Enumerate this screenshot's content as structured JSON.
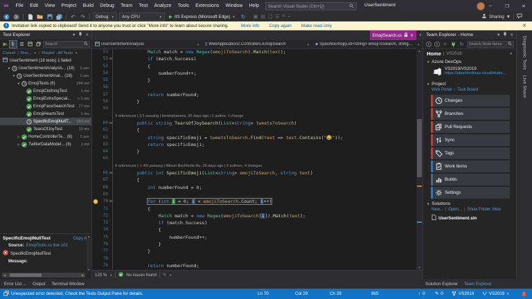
{
  "window": {
    "title": "UserSentiment",
    "search_placeholder": "Search Visual Studio (Ctrl+Q)",
    "minimize": "─",
    "maximize": "❐",
    "close": "✕"
  },
  "menu": [
    "File",
    "Edit",
    "View",
    "Project",
    "Build",
    "Debug",
    "Team",
    "Test",
    "Analyze",
    "Tools",
    "Extensions",
    "Window",
    "Help"
  ],
  "toolbar": {
    "config": "Debug",
    "platform": "Any CPU",
    "start": "IIS Express (Microsoft Edge)",
    "sharing": "Sharing"
  },
  "notification": {
    "text": "Invitation link copied to clipboard! Send it to anyone you trust or click \"More info\" to learn about secure sharing.",
    "links": [
      "More info",
      "Copy again",
      "Make read-only"
    ]
  },
  "test_explorer": {
    "title": "Test Explorer",
    "search_placeholder": "Search",
    "cmd_cancel": "Cancel",
    "cmd_run": "Run...",
    "cmd_playlist": "Playlist : All Tests",
    "root_label": "UserSentiment (18 tests) 1 failed",
    "tree": [
      {
        "label": "UserSentimentAnalysis... (18)",
        "time": "1 sec",
        "icon": "clock",
        "indent": 1,
        "expander": "open"
      },
      {
        "label": "UserSentimentAnal... (18)",
        "time": "1 sec",
        "icon": "clock",
        "indent": 2,
        "expander": "open"
      },
      {
        "label": "EmojiTests (6)",
        "time": "244 ms",
        "icon": "clock",
        "indent": 3,
        "expander": "open"
      },
      {
        "label": "EmojiClothingTest",
        "time": "1 ms",
        "icon": "pass",
        "indent": 4
      },
      {
        "label": "EmojiExtraSpecial...",
        "time": "< 1 ms",
        "icon": "pass",
        "indent": 4
      },
      {
        "label": "EmojiFaceSearchTest",
        "time": "77 ms",
        "icon": "pass",
        "indent": 4
      },
      {
        "label": "EmojiHeartsTest",
        "time": "1 ms",
        "icon": "pass",
        "indent": 4
      },
      {
        "label": "SpecificEmojiNullT...",
        "time": "153 ms",
        "icon": "clock",
        "indent": 4,
        "selected": true
      },
      {
        "label": "TearsOfJoyTest",
        "time": "10 ms",
        "icon": "pass",
        "indent": 4
      },
      {
        "label": "HomeControllerTe... (6)",
        "time": "1 sec",
        "icon": "pass",
        "indent": 3,
        "expander": "closed"
      },
      {
        "label": "TwitterDataModel... (6)",
        "time": "1 ms",
        "icon": "pass",
        "indent": 3,
        "expander": "closed"
      }
    ],
    "detail": {
      "title": "SpecificEmojiNullTest",
      "copy_all": "Copy All",
      "source_label": "Source:",
      "source_link": "EmojiTests.cs line 101",
      "failed_test": "SpecificEmojiNullTest",
      "message_label": "Message:"
    }
  },
  "editor": {
    "tab_title": "EmojiSearch.cs",
    "breadcrumb": [
      "UserSentimentAnalysis",
      "WebApplication2.Controllers.EmojiSearch",
      "SpecificEmoji(List<string> emojiToSearch, string..."
    ],
    "zoom_level": "125 %",
    "issues_status": "No issues found",
    "lines": [
      {
        "n": "51",
        "tok": [
          [
            "p",
            "            "
          ],
          [
            "t",
            "Match"
          ],
          [
            "p",
            " match = "
          ],
          [
            "k",
            "new"
          ],
          [
            "p",
            " "
          ],
          [
            "t",
            "Regex"
          ],
          [
            "p",
            "("
          ],
          [
            "a",
            "emojiToSearch"
          ],
          [
            "p",
            ")."
          ],
          [
            "m",
            "Match"
          ],
          [
            "p",
            "("
          ],
          [
            "a",
            "text"
          ],
          [
            "p",
            ");"
          ]
        ]
      },
      {
        "n": "52",
        "fold": true,
        "tok": [
          [
            "p",
            "            "
          ],
          [
            "k",
            "if"
          ],
          [
            "p",
            " (match.Success)"
          ]
        ]
      },
      {
        "n": "53",
        "tok": [
          [
            "p",
            "            {"
          ]
        ]
      },
      {
        "n": "54",
        "tok": [
          [
            "p",
            "                numberFound++;"
          ]
        ]
      },
      {
        "n": "55",
        "tok": [
          [
            "p",
            "            }"
          ]
        ]
      },
      {
        "n": "56",
        "tok": []
      },
      {
        "n": "57",
        "tok": [
          [
            "p",
            "            "
          ],
          [
            "k",
            "return"
          ],
          [
            "p",
            " numberFound;"
          ]
        ]
      },
      {
        "n": "58",
        "tok": [
          [
            "p",
            "        }"
          ]
        ]
      },
      {
        "n": "59",
        "tok": []
      },
      {
        "lens": true,
        "tok": [
          [
            "L",
            "3 references | 1/1 passing | kendrahavens, 35 days ago | 1 author, 1 change"
          ]
        ]
      },
      {
        "n": "60",
        "fold": true,
        "tok": [
          [
            "p",
            "        "
          ],
          [
            "k",
            "public"
          ],
          [
            "p",
            " "
          ],
          [
            "k",
            "string"
          ],
          [
            "p",
            " "
          ],
          [
            "m",
            "TearsOfJoySearch"
          ],
          [
            "p",
            "("
          ],
          [
            "t",
            "List"
          ],
          [
            "p",
            "<"
          ],
          [
            "k",
            "string"
          ],
          [
            "p",
            "> "
          ],
          [
            "a",
            "tweetsToSearch"
          ],
          [
            "p",
            ")"
          ]
        ]
      },
      {
        "n": "61",
        "tok": [
          [
            "p",
            "        {"
          ]
        ]
      },
      {
        "n": "62",
        "tok": [
          [
            "p",
            "            "
          ],
          [
            "k",
            "string"
          ],
          [
            "p",
            " specificEmoji = "
          ],
          [
            "a",
            "tweetsToSearch"
          ],
          [
            "p",
            "."
          ],
          [
            "m",
            "Find"
          ],
          [
            "p",
            "("
          ],
          [
            "a",
            "text"
          ],
          [
            "p",
            " => "
          ],
          [
            "a",
            "text"
          ],
          [
            "p",
            "."
          ],
          [
            "m",
            "Contains"
          ],
          [
            "p",
            "("
          ],
          [
            "s",
            "\""
          ],
          [
            "e",
            "😂"
          ],
          [
            "s",
            "\""
          ],
          [
            "p",
            "));"
          ]
        ]
      },
      {
        "n": "63",
        "tok": [
          [
            "p",
            "            "
          ],
          [
            "k",
            "return"
          ],
          [
            "p",
            " specificEmoji;"
          ]
        ]
      },
      {
        "n": "64",
        "tok": [
          [
            "p",
            "        }"
          ]
        ]
      },
      {
        "n": "65",
        "tok": []
      },
      {
        "lens": true,
        "tok": [
          [
            "L",
            "5 references | "
          ],
          [
            "Lf",
            "✕ "
          ],
          [
            "L",
            "4/5 passing | Allison Buchholtz-Au, 29 days ago | 2 authors, 4 changes"
          ]
        ]
      },
      {
        "n": "66",
        "fold": true,
        "tok": [
          [
            "p",
            "        "
          ],
          [
            "k",
            "public"
          ],
          [
            "p",
            " "
          ],
          [
            "k",
            "int"
          ],
          [
            "p",
            " "
          ],
          [
            "m",
            "SpecificEmoji"
          ],
          [
            "p",
            "("
          ],
          [
            "t",
            "List"
          ],
          [
            "p",
            "<"
          ],
          [
            "k",
            "string"
          ],
          [
            "p",
            "> "
          ],
          [
            "a",
            "emojiToSearch"
          ],
          [
            "p",
            ", "
          ],
          [
            "k",
            "string"
          ],
          [
            "p",
            " "
          ],
          [
            "a",
            "text"
          ],
          [
            "p",
            ")"
          ]
        ]
      },
      {
        "n": "67",
        "tok": [
          [
            "p",
            "        {"
          ]
        ]
      },
      {
        "n": "68",
        "tok": [
          [
            "p",
            "            "
          ],
          [
            "k",
            "int"
          ],
          [
            "p",
            " numberFound = "
          ],
          [
            "d",
            "0"
          ],
          [
            "p",
            ";"
          ]
        ]
      },
      {
        "n": "69",
        "tok": []
      },
      {
        "n": "70",
        "fold": true,
        "bulb": true,
        "box": true,
        "tok": [
          [
            "p",
            "            "
          ],
          [
            "k",
            "for"
          ],
          [
            "p",
            " ("
          ],
          [
            "k",
            "int"
          ],
          [
            "p",
            " "
          ],
          [
            "g",
            "i"
          ],
          [
            "p",
            " = "
          ],
          [
            "d",
            "0"
          ],
          [
            "p",
            "; "
          ],
          [
            "b",
            "i"
          ],
          [
            "p",
            " < "
          ],
          [
            "a",
            "emojiToSearch"
          ],
          [
            "p",
            ".Count; "
          ],
          [
            "b",
            "i"
          ],
          [
            "p",
            "++)"
          ]
        ]
      },
      {
        "n": "71",
        "tok": [
          [
            "p",
            "            {"
          ]
        ]
      },
      {
        "n": "72",
        "tok": [
          [
            "p",
            "                "
          ],
          [
            "t",
            "Match"
          ],
          [
            "p",
            " match = "
          ],
          [
            "k",
            "new"
          ],
          [
            "p",
            " "
          ],
          [
            "t",
            "Regex"
          ],
          [
            "p",
            "("
          ],
          [
            "a",
            "emojiToSearch"
          ],
          [
            "p",
            "["
          ],
          [
            "b",
            "i"
          ],
          [
            "p",
            "])."
          ],
          [
            "m",
            "Match"
          ],
          [
            "p",
            "("
          ],
          [
            "a",
            "text"
          ],
          [
            "p",
            ");"
          ]
        ]
      },
      {
        "n": "73",
        "tok": [
          [
            "p",
            "                "
          ],
          [
            "k",
            "if"
          ],
          [
            "p",
            " (match.Success)"
          ]
        ]
      },
      {
        "n": "74",
        "tok": [
          [
            "p",
            "                {"
          ]
        ]
      },
      {
        "n": "75",
        "tok": [
          [
            "p",
            "                    numberFound++;"
          ]
        ]
      },
      {
        "n": "76",
        "tok": [
          [
            "p",
            "                }"
          ]
        ]
      },
      {
        "n": "77",
        "tok": [
          [
            "p",
            "            }"
          ]
        ]
      },
      {
        "n": "78",
        "tok": []
      },
      {
        "n": "79",
        "tok": [
          [
            "p",
            "            "
          ],
          [
            "k",
            "return"
          ],
          [
            "p",
            " numberFound;"
          ]
        ]
      }
    ]
  },
  "team_explorer": {
    "title": "Team Explorer - Home",
    "search_placeholder": "Search Work Items",
    "page": "Home",
    "context": "VS2019",
    "azure": {
      "label": "Azure DevOps",
      "account": "VS2019/VS2019",
      "url": "https://abuchholtzau.visualstudio..."
    },
    "project": {
      "label": "Project",
      "links": [
        "Web Portal",
        "Task Board"
      ],
      "buttons": [
        {
          "label": "Changes",
          "icon": "tClock",
          "color": "#a04a42"
        },
        {
          "label": "Branches",
          "icon": "tBranch",
          "color": "#a04a42"
        },
        {
          "label": "Pull Requests",
          "icon": "tPR",
          "color": "#a04a42"
        },
        {
          "label": "Sync",
          "icon": "tSync",
          "color": "#a04a42"
        },
        {
          "label": "Tags",
          "icon": "tTag",
          "color": "#a04a42"
        },
        {
          "label": "Work Items",
          "icon": "tWork",
          "color": "#3f6fa8"
        },
        {
          "label": "Builds",
          "icon": "tBuilds",
          "color": "#5a6275"
        },
        {
          "label": "Settings",
          "icon": "tGear",
          "color": "#3f6fa8"
        }
      ]
    },
    "solutions": {
      "label": "Solutions",
      "links": [
        "New...",
        "Open...",
        "Show Folder View"
      ],
      "solution": "UserSentiment.sln"
    }
  },
  "side_tabs": [
    "Diagnostic Tools",
    "Live Share"
  ],
  "panel_tabs_left": [
    "Error List ...",
    "Output",
    "Terminal Window"
  ],
  "panel_tabs_right": [
    "Solution Explorer",
    "Team Explorer"
  ],
  "status_bar": {
    "message": "Unexpected error detected. Check the Tests Output Pane for details.",
    "ln": "Ln 70",
    "col": "Col 29",
    "ch": "Ch 29",
    "mode": "INS",
    "pushes": "0",
    "edits": "0",
    "repo": "VS2019",
    "branch": "VS2019"
  },
  "colors": {
    "status_bar": "#1173c5",
    "preview_tab": "#93288b",
    "notification_bg": "#fbf5cd",
    "pass_green": "#3f9948",
    "fail_red": "#c74a3c"
  }
}
